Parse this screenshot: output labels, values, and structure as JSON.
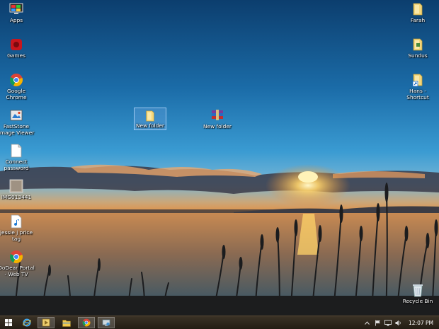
{
  "desktop": {
    "left_icons": [
      {
        "label": "Apps",
        "icon": "monitor-icon"
      },
      {
        "label": "Games",
        "icon": "games-icon"
      },
      {
        "label": "Google Chrome",
        "icon": "chrome-icon"
      },
      {
        "label": "FastStone Image Viewer",
        "icon": "faststone-icon"
      },
      {
        "label": "Connect password",
        "icon": "document-icon"
      },
      {
        "label": "IMG013441",
        "icon": "image-file-icon"
      },
      {
        "label": "jessie j price tag",
        "icon": "audio-file-icon"
      },
      {
        "label": "DoDear Portal - Web TV",
        "icon": "chrome-shortcut-icon"
      }
    ],
    "right_icons": [
      {
        "label": "Farah",
        "icon": "folder-icon"
      },
      {
        "label": "Sundus",
        "icon": "folder-icon"
      },
      {
        "label": "Hans - Shortcut",
        "icon": "folder-shortcut-icon"
      }
    ],
    "center_icons": [
      {
        "label": "New folder",
        "icon": "folder-icon",
        "selected": true
      },
      {
        "label": "New folder",
        "icon": "winrar-icon",
        "selected": false
      }
    ],
    "recycle_bin": {
      "label": "Recycle Bin",
      "icon": "recycle-bin-icon"
    }
  },
  "taskbar": {
    "buttons": [
      "windows-start-icon",
      "internet-explorer-icon",
      "media-player-icon",
      "file-explorer-icon",
      "chrome-icon",
      "network-app-icon"
    ],
    "tray": [
      "show-hidden-icons-chevron",
      "flag-icon",
      "network-icon",
      "volume-icon"
    ],
    "clock": "12:07 PM"
  },
  "colors": {
    "sky_top": "#0f4e86",
    "sky_mid": "#2f8fc9",
    "horizon_glow": "#f5b043",
    "sun": "#fff2b0",
    "water": "#a6734a",
    "taskbar": "#2e261b"
  }
}
